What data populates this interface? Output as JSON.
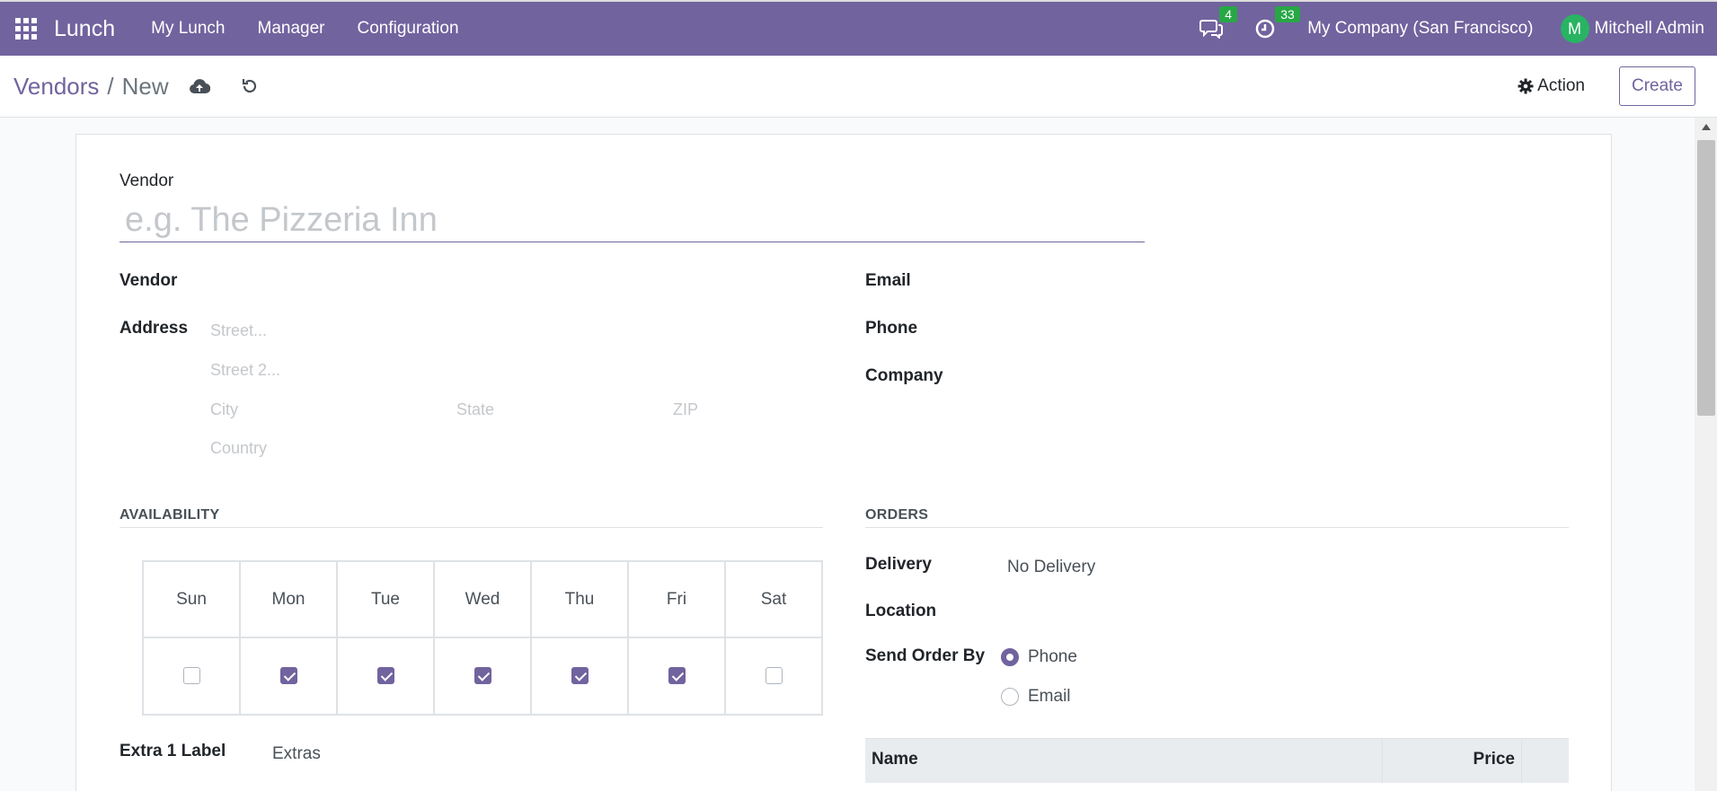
{
  "navbar": {
    "app_name": "Lunch",
    "menu": [
      "My Lunch",
      "Manager",
      "Configuration"
    ],
    "messages_count": "4",
    "activities_count": "33",
    "company": "My Company (San Francisco)",
    "user_initial": "M",
    "user_name": "Mitchell Admin"
  },
  "control_panel": {
    "breadcrumb_parent": "Vendors",
    "breadcrumb_sep": "/",
    "breadcrumb_current": "New",
    "action_label": "Action",
    "create_label": "Create"
  },
  "form": {
    "vendor_title_label": "Vendor",
    "vendor_title_placeholder": "e.g. The Pizzeria Inn",
    "vendor_label": "Vendor",
    "address_label": "Address",
    "street_placeholder": "Street...",
    "street2_placeholder": "Street 2...",
    "city_placeholder": "City",
    "state_placeholder": "State",
    "zip_placeholder": "ZIP",
    "country_placeholder": "Country",
    "email_label": "Email",
    "phone_label": "Phone",
    "company_label": "Company",
    "availability_title": "AVAILABILITY",
    "orders_title": "ORDERS",
    "days": [
      {
        "label": "Sun",
        "checked": false
      },
      {
        "label": "Mon",
        "checked": true
      },
      {
        "label": "Tue",
        "checked": true
      },
      {
        "label": "Wed",
        "checked": true
      },
      {
        "label": "Thu",
        "checked": true
      },
      {
        "label": "Fri",
        "checked": true
      },
      {
        "label": "Sat",
        "checked": false
      }
    ],
    "delivery_label": "Delivery",
    "delivery_value": "No Delivery",
    "location_label": "Location",
    "send_order_by_label": "Send Order By",
    "send_options": [
      {
        "label": "Phone",
        "selected": true
      },
      {
        "label": "Email",
        "selected": false
      }
    ],
    "extra1_label": "Extra 1 Label",
    "extra1_value": "Extras",
    "products_columns": {
      "name": "Name",
      "price": "Price"
    }
  },
  "colors": {
    "brand": "#71639e",
    "badge": "#28a745",
    "avatar": "#28b463"
  }
}
